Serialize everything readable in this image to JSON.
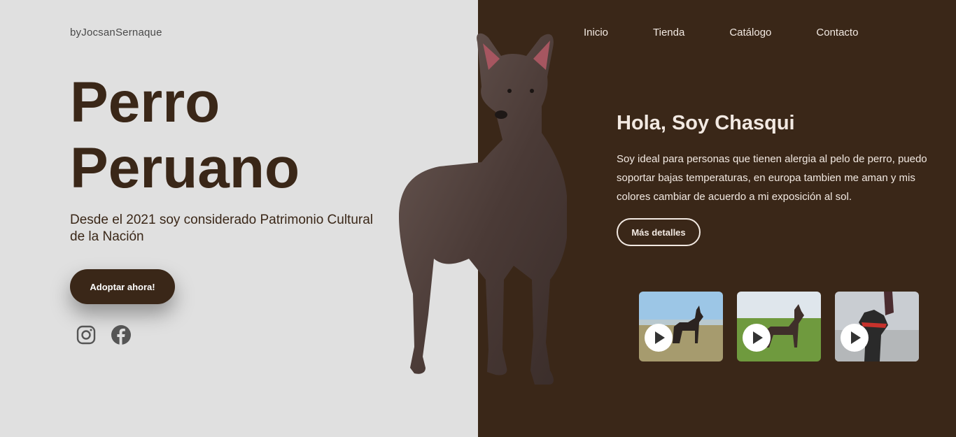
{
  "brand": "byJocsanSernaque",
  "hero": {
    "title_line1": "Perro",
    "title_line2": "Peruano",
    "subtitle": "Desde el 2021 soy considerado Patrimonio Cultural de la Nación",
    "adopt_label": "Adoptar ahora!"
  },
  "social": [
    "instagram-icon",
    "facebook-icon"
  ],
  "nav": {
    "items": [
      {
        "label": "Inicio"
      },
      {
        "label": "Tienda"
      },
      {
        "label": "Catálogo"
      },
      {
        "label": "Contacto"
      }
    ]
  },
  "intro": {
    "title": "Hola, Soy Chasqui",
    "text": "Soy ideal para personas que tienen alergia al pelo de perro, puedo soportar bajas temperaturas, en europa tambien me aman y mis colores cambiar de acuerdo a mi exposición al sol.",
    "details_label": "Más detalles"
  },
  "videos": [
    "play-icon",
    "play-icon",
    "play-icon"
  ],
  "colors": {
    "left_bg": "#e0e0e0",
    "right_bg": "#3a2718",
    "accent": "#3a2718",
    "light_text": "#f2e9e2"
  }
}
